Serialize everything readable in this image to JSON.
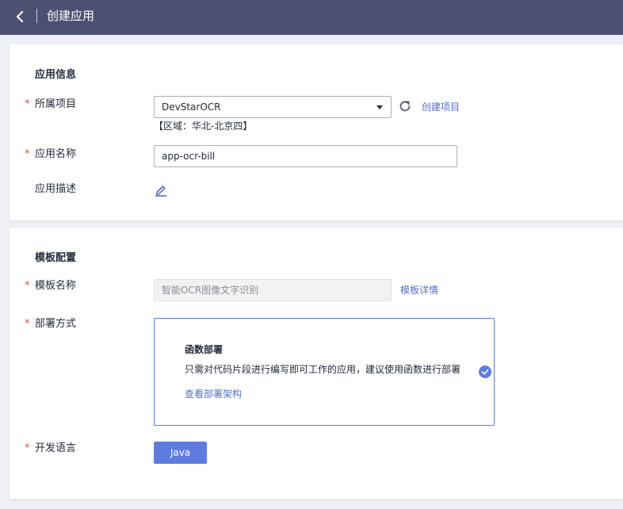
{
  "header": {
    "title": "创建应用"
  },
  "app_info": {
    "section_title": "应用信息",
    "required_mark": "*",
    "project_label": "所属项目",
    "project_value": "DevStarOCR",
    "create_project_link": "创建项目",
    "region_text": "【区域：华北-北京四】",
    "name_label": "应用名称",
    "name_value": "app-ocr-bill",
    "desc_label": "应用描述"
  },
  "template": {
    "section_title": "模板配置",
    "name_label": "模板名称",
    "name_value": "智能OCR图像文字识别",
    "detail_link": "模板详情",
    "deploy_label": "部署方式",
    "deploy_title": "函数部署",
    "deploy_desc": "只需对代码片段进行编写即可工作的应用，建议使用函数进行部署",
    "deploy_arch_link": "查看部署架构",
    "lang_label": "开发语言",
    "lang_button": "Java"
  },
  "colors": {
    "header_bg": "#4c5174",
    "accent": "#5e7ce0",
    "link": "#526ecc",
    "required": "#e54545"
  }
}
